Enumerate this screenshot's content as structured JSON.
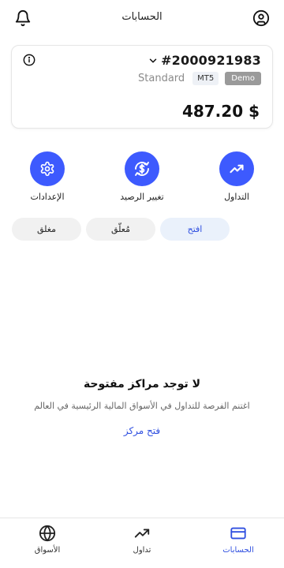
{
  "header": {
    "title": "الحسابات",
    "bell_icon": "bell-icon",
    "profile_icon": "user-circle-icon"
  },
  "account": {
    "number": "#2000921983",
    "type": "Standard",
    "platform": "MT5",
    "mode": "Demo",
    "balance": "487.20 $"
  },
  "actions": [
    {
      "label": "التداول",
      "icon": "trending-up-icon"
    },
    {
      "label": "تغيير الرصيد",
      "icon": "dollar-refresh-icon"
    },
    {
      "label": "الإعدادات",
      "icon": "gear-icon"
    }
  ],
  "filters": {
    "open": "افتح",
    "pending": "مُعلّق",
    "closed": "مغلق",
    "selected": "open"
  },
  "empty_state": {
    "title": "لا توجد مراكز مفتوحة",
    "subtitle": "اغتنم الفرصة للتداول في الأسواق المالية الرئيسية في العالم",
    "link": "فتح مركز"
  },
  "bottom_nav": {
    "accounts": "الحسابات",
    "trade": "تداول",
    "markets": "الأسواق",
    "active": "accounts"
  },
  "colors": {
    "accent": "#3d5afe",
    "link": "#2f4fe0",
    "chip_active_bg": "#eaf1fb"
  }
}
